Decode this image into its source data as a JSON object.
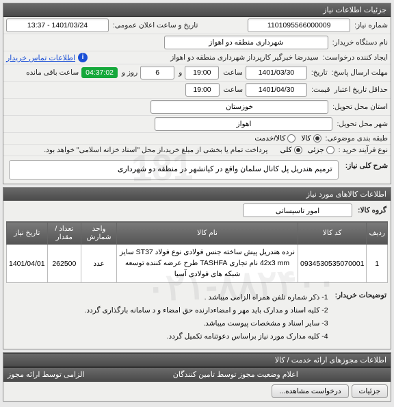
{
  "panel1_title": "جزئیات اطلاعات نیاز",
  "need_no_label": "شماره نیاز:",
  "need_no": "1101095566000009",
  "public_datetime_label": "تاریخ و ساعت اعلان عمومی:",
  "public_datetime": "1401/03/24 - 13:37",
  "buyer_label": "نام دستگاه خریدار:",
  "buyer": "شهرداری منطقه دو اهواز",
  "requester_label": "ایجاد کننده درخواست:",
  "requester": "سیدرضا خبرگیر کارپرداز  شهرداری منطقه دو اهواز",
  "contact_link": "اطلاعات تماس خریدار",
  "deadline_send_label": "مهلت ارسال پاسخ:",
  "deadline_till_label": "تاریخ:",
  "deadline_date": "1401/03/30",
  "time_label": "ساعت",
  "deadline_time": "19:00",
  "and_label": "و",
  "days": "6",
  "day_label": "روز و",
  "remaining": "04:37:02",
  "remaining_label": "ساعت باقی مانده",
  "price_valid_label": "حداقل تاریخ اعتبار",
  "price_label": "قیمت:",
  "price_date": "1401/04/30",
  "price_time": "19:00",
  "province_label": "استان محل تحویل:",
  "province": "خوزستان",
  "city_label": "شهر محل تحویل:",
  "city": "اهواز",
  "classification_label": "طبقه بندی موضوعی:",
  "radio_goods": "کالا",
  "radio_service": "کالا/خدمت",
  "buy_process_label": "نوع فرآیند خرید :",
  "radio_partial": "جزئی",
  "radio_full": "کلی",
  "pay_note": "پرداخت تمام یا بخشی از مبلغ خرید،از محل \"اسناد خزانه اسلامی\" خواهد بود.",
  "desc_label": "شرح کلی نیاز:",
  "desc": "ترمیم هندریل پل کانال سلمان واقع در کیانشهر در منطقه دو شهرداری",
  "goods_header": "اطلاعات کالاهای مورد نیاز",
  "goods_group_label": "گروه کالا:",
  "goods_group": "امور تاسیساتی",
  "th_row": "ردیف",
  "th_code": "کد کالا",
  "th_name": "نام کالا",
  "th_unit": "واحد شمارش",
  "th_qty": "تعداد / مقدار",
  "th_date": "تاریخ نیاز",
  "row_no": "1",
  "row_code": "0934530535070001",
  "row_name": "نرده هندریل پیش ساخته جنس فولادی نوع فولاد ST37 سایز 42x3 mm نام تجاری TASHFA طرح عرضه کننده توسعه شبکه های فولادی آسیا",
  "row_unit": "عدد",
  "row_qty": "262500",
  "row_date": "1401/04/01",
  "buyer_notes_label": "توضیحات خریدار:",
  "note1": "1- ذکر شماره تلفن همراه الزامی میباشد .",
  "note2": "2- کلیه اسناد و مدارک باید مهر و امضاءدارنده حق امضاء و د سامانه بارگذاری گردد.",
  "note3": "3- سایر اسناد و مشخصات پیوست میباشد.",
  "note4": "4- کلیه مدارک مورد نیاز براساس دعوتنامه تکمیل گردد.",
  "bar1": "اطلاعات مجوزهای ارائه خدمت / کالا",
  "bar2": "اعلام وضعیت مجوز توسط تامین کنندگان",
  "bar3": "الزامی توسط ارائه مجوز",
  "btn_detail": "جزئیات",
  "btn_history": "درخواست مشاهده..."
}
